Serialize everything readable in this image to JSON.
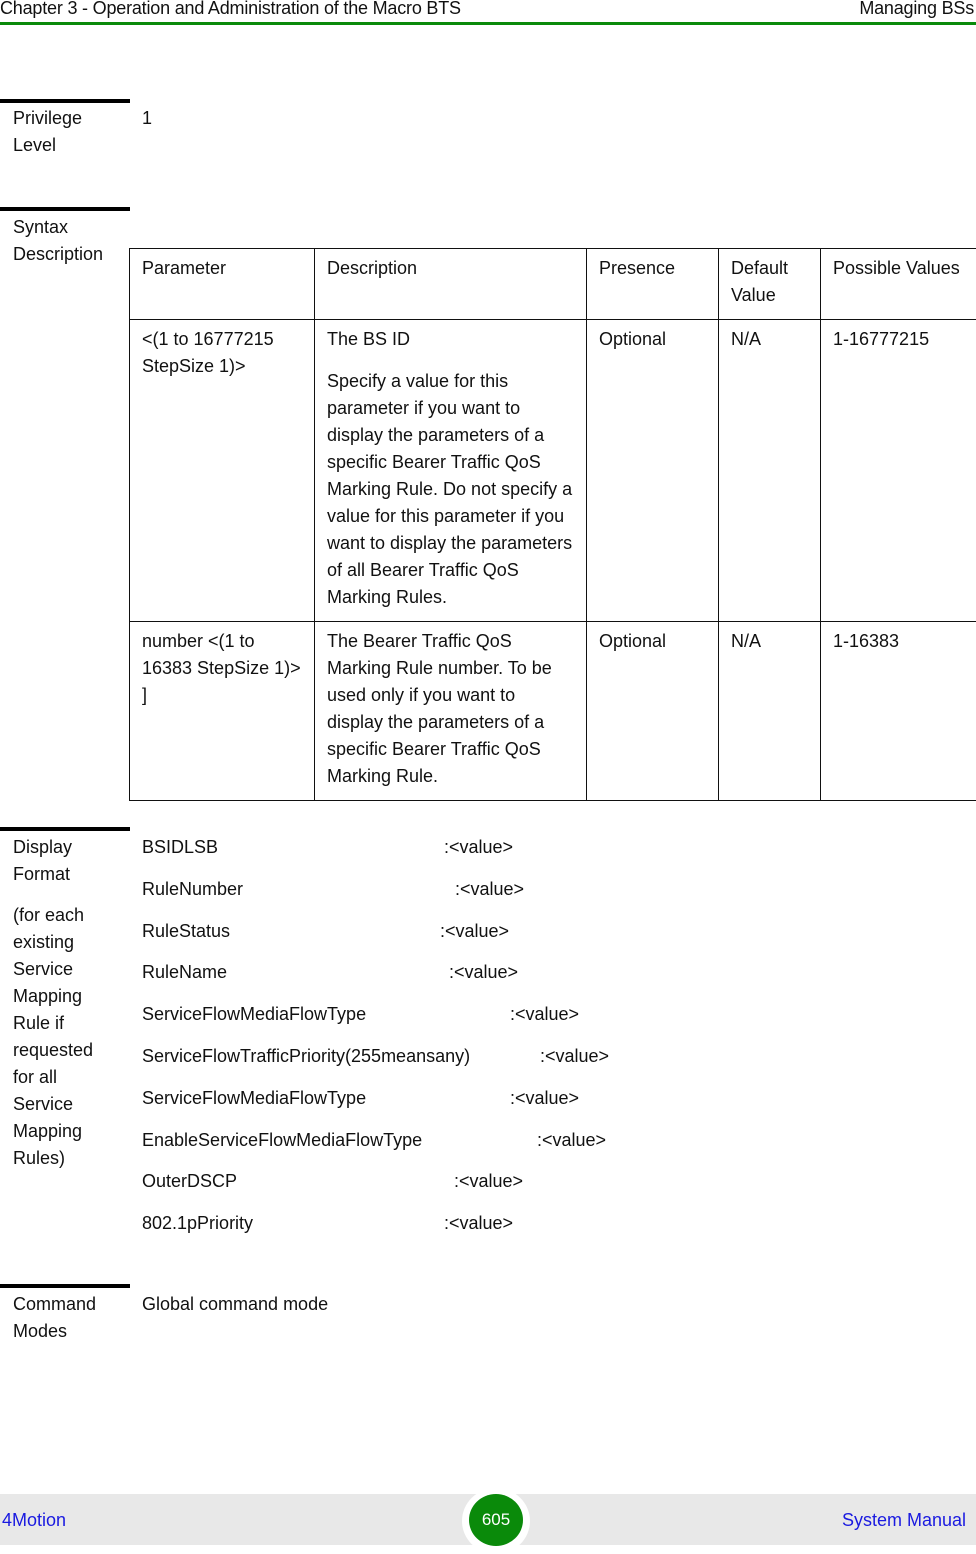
{
  "header": {
    "chapter": "Chapter 3 - Operation and Administration of the Macro BTS",
    "section": "Managing BSs",
    "accent_color": "#0a8a0a"
  },
  "privilege": {
    "label_lines": [
      "Privilege",
      "Level"
    ],
    "value": "1"
  },
  "syntax": {
    "label_lines": [
      "Syntax",
      "Description"
    ],
    "table": {
      "headers": [
        "Parameter",
        "Description",
        "Presence",
        "Default Value",
        "Possible Values"
      ],
      "rows": [
        {
          "parameter": "<(1 to 16777215 StepSize 1)>",
          "description": [
            "The BS ID",
            "Specify a value for this parameter if you want to display the parameters of a specific Bearer Traffic QoS Marking Rule. Do not specify a value for this parameter if you want to display the parameters of all Bearer Traffic QoS Marking Rules."
          ],
          "presence": "Optional",
          "default": "N/A",
          "possible": "1-16777215"
        },
        {
          "parameter": "number <(1 to 16383 StepSize 1)> ]",
          "description": [
            "The Bearer Traffic QoS Marking Rule number. To be used only if you want to display the parameters of a specific Bearer Traffic QoS Marking Rule."
          ],
          "presence": "Optional",
          "default": "N/A",
          "possible": "1-16383"
        }
      ]
    }
  },
  "display_format": {
    "label_lines": [
      "Display",
      "Format"
    ],
    "sub_label_lines": [
      "(for each",
      "existing",
      "Service",
      "Mapping",
      "Rule if",
      "requested",
      "for all",
      "Service",
      "Mapping",
      "Rules)"
    ],
    "rows": [
      {
        "key": "BSIDLSB",
        "val": ":<value>"
      },
      {
        "key": "RuleNumber",
        "val": ":<value>"
      },
      {
        "key": "RuleStatus",
        "val": ":<value>"
      },
      {
        "key": "RuleName",
        "val": ":<value>"
      },
      {
        "key": "ServiceFlowMediaFlowType",
        "val": ":<value>"
      },
      {
        "key": "ServiceFlowTrafficPriority(255meansany)",
        "val": ":<value>"
      },
      {
        "key": "ServiceFlowMediaFlowType",
        "val": ":<value>"
      },
      {
        "key": "EnableServiceFlowMediaFlowType",
        "val": ":<value>"
      },
      {
        "key": "OuterDSCP",
        "val": ":<value>"
      },
      {
        "key": "802.1pPriority",
        "val": ":<value>"
      }
    ]
  },
  "command_modes": {
    "label_lines": [
      "Command",
      "Modes"
    ],
    "value": "Global command mode"
  },
  "footer": {
    "left": "4Motion",
    "page_number": "605",
    "right": "System Manual"
  }
}
